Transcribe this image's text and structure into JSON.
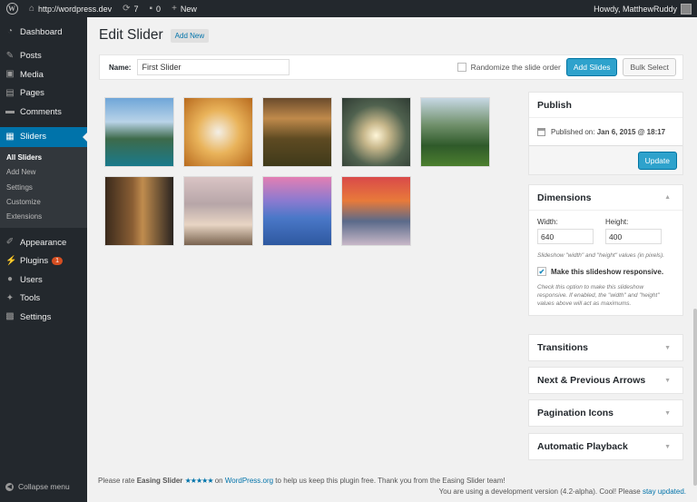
{
  "adminbar": {
    "site_url": "http://wordpress.dev",
    "updates_count": "7",
    "comments_count": "0",
    "new_label": "New",
    "howdy": "Howdy, MatthewRuddy"
  },
  "sidebar": {
    "items": [
      {
        "label": "Dashboard",
        "icon": "dashboard-icon"
      },
      {
        "label": "Posts",
        "icon": "pushpin-icon"
      },
      {
        "label": "Media",
        "icon": "media-icon"
      },
      {
        "label": "Pages",
        "icon": "pages-icon"
      },
      {
        "label": "Comments",
        "icon": "comment-icon"
      },
      {
        "label": "Sliders",
        "icon": "sliders-icon"
      },
      {
        "label": "Appearance",
        "icon": "brush-icon"
      },
      {
        "label": "Plugins",
        "icon": "plug-icon",
        "badge": "1"
      },
      {
        "label": "Users",
        "icon": "users-icon"
      },
      {
        "label": "Tools",
        "icon": "wrench-icon"
      },
      {
        "label": "Settings",
        "icon": "settings-icon"
      }
    ],
    "submenu": [
      "All Sliders",
      "Add New",
      "Settings",
      "Customize",
      "Extensions"
    ],
    "collapse_label": "Collapse menu"
  },
  "main": {
    "title": "Edit Slider",
    "add_new_label": "Add New",
    "name_label": "Name:",
    "name_value": "First Slider",
    "randomize_label": "Randomize the slide order",
    "add_slides_label": "Add Slides",
    "bulk_select_label": "Bulk Select"
  },
  "publish": {
    "title": "Publish",
    "published_prefix": "Published on:",
    "published_date": "Jan 6, 2015 @ 18:17",
    "update_label": "Update"
  },
  "dimensions": {
    "title": "Dimensions",
    "width_label": "Width:",
    "width_value": "640",
    "height_label": "Height:",
    "height_value": "400",
    "hint": "Slideshow \"width\" and \"height\" values (in pixels).",
    "responsive_label": "Make this slideshow responsive.",
    "responsive_hint": "Check this option to make this slideshow responsive. If enabled, the \"width\" and \"height\" values above will act as maximums."
  },
  "panels": [
    "Transitions",
    "Next & Previous Arrows",
    "Pagination Icons",
    "Automatic Playback"
  ],
  "footer": {
    "rate_prefix": "Please rate",
    "plugin_name": "Easing Slider",
    "stars": "★★★★★",
    "on": "on",
    "wp_link": "WordPress.org",
    "rate_suffix": "to help us keep this plugin free. Thank you from the Easing Slider team!",
    "version_text": "You are using a development version (4.2-alpha). Cool! Please",
    "stay_updated": "stay updated."
  },
  "colors": {
    "admin_dark": "#23282d",
    "accent_blue": "#0073aa",
    "button_blue": "#2ea2cc"
  }
}
